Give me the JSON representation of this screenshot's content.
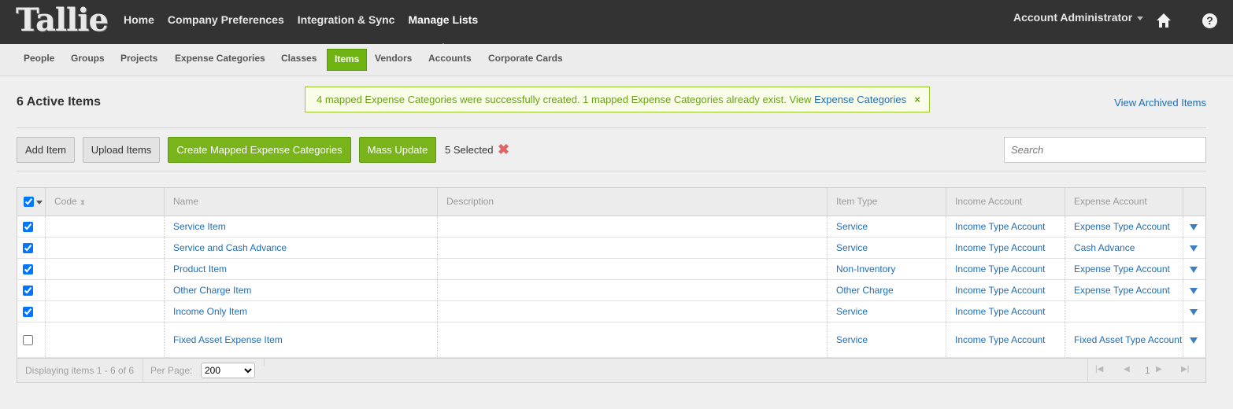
{
  "app": {
    "logo": "Tallie"
  },
  "header": {
    "nav": [
      "Home",
      "Company Preferences",
      "Integration & Sync",
      "Manage Lists"
    ],
    "active_nav": "Manage Lists",
    "account": "Account Administrator",
    "help": "?"
  },
  "subnav": {
    "items": [
      "People",
      "Groups",
      "Projects",
      "Expense Categories",
      "Classes",
      "Items",
      "Vendors",
      "Accounts",
      "Corporate Cards"
    ],
    "active": "Items"
  },
  "page": {
    "title": "6 Active Items",
    "notice": {
      "text": "4 mapped Expense Categories were successfully created. 1 mapped Expense Categories already exist. View ",
      "link": "Expense Categories",
      "close": "×"
    },
    "archived_link": "View Archived Items"
  },
  "toolbar": {
    "add_item": "Add Item",
    "upload_items": "Upload Items",
    "create_mapped": "Create Mapped Expense Categories",
    "mass_update": "Mass Update",
    "selected": "5 Selected",
    "clear": "✖"
  },
  "search": {
    "placeholder": "Search"
  },
  "table": {
    "columns": [
      "Code",
      "Name",
      "Description",
      "Item Type",
      "Income Account",
      "Expense Account"
    ],
    "rows": [
      {
        "checked": true,
        "code": "",
        "name": "Service Item",
        "description": "",
        "item_type": "Service",
        "income_account": "Income Type Account",
        "expense_account": "Expense Type Account"
      },
      {
        "checked": true,
        "code": "",
        "name": "Service and Cash Advance",
        "description": "",
        "item_type": "Service",
        "income_account": "Income Type Account",
        "expense_account": "Cash Advance"
      },
      {
        "checked": true,
        "code": "",
        "name": "Product Item",
        "description": "",
        "item_type": "Non-Inventory",
        "income_account": "Income Type Account",
        "expense_account": "Expense Type Account"
      },
      {
        "checked": true,
        "code": "",
        "name": "Other Charge Item",
        "description": "",
        "item_type": "Other Charge",
        "income_account": "Income Type Account",
        "expense_account": "Expense Type Account"
      },
      {
        "checked": true,
        "code": "",
        "name": "Income Only Item",
        "description": "",
        "item_type": "Service",
        "income_account": "Income Type Account",
        "expense_account": ""
      },
      {
        "checked": false,
        "code": "",
        "name": "Fixed Asset Expense Item",
        "description": "",
        "item_type": "Service",
        "income_account": "Income Type Account",
        "expense_account": "Fixed Asset Type Account"
      }
    ]
  },
  "footer": {
    "display": "Displaying items 1 - 6 of 6",
    "per_page_label": "Per Page:",
    "per_page_value": "200",
    "page": "1",
    "pager_first": "|◀",
    "pager_prev": "◀",
    "pager_next": "▶",
    "pager_last": "▶|"
  },
  "colors": {
    "brand_green": "#78b41a",
    "link_blue": "#1f6db5",
    "topbar": "#333333"
  }
}
